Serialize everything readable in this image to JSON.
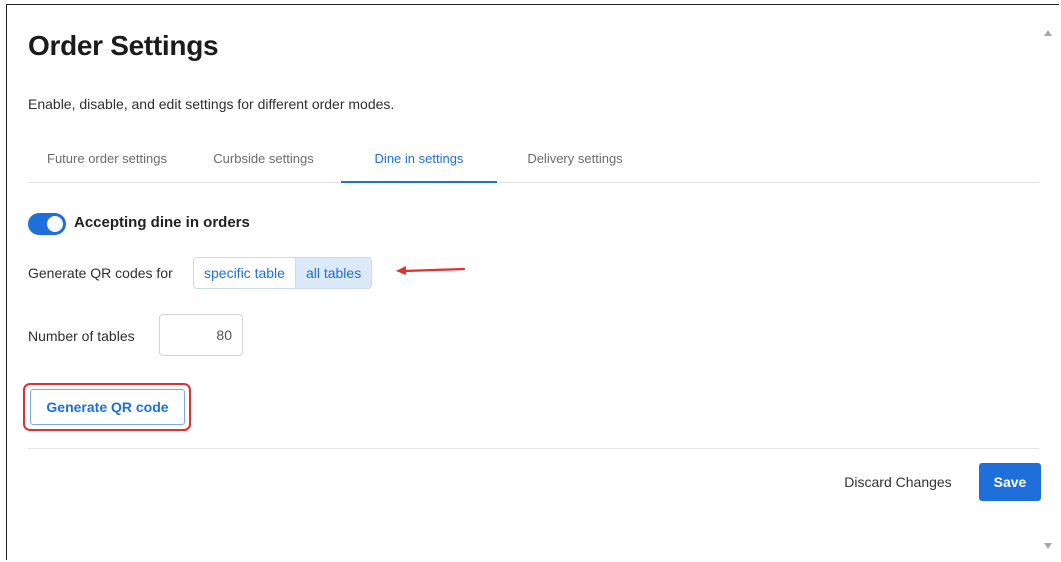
{
  "page": {
    "title": "Order Settings",
    "subtitle": "Enable, disable, and edit settings for different order modes."
  },
  "tabs": [
    {
      "label": "Future order settings",
      "active": false
    },
    {
      "label": "Curbside settings",
      "active": false
    },
    {
      "label": "Dine in settings",
      "active": true
    },
    {
      "label": "Delivery settings",
      "active": false
    }
  ],
  "dine_in": {
    "toggle_on": true,
    "toggle_label": "Accepting dine in orders",
    "qr_label": "Generate QR codes for",
    "qr_options": [
      "specific table",
      "all tables"
    ],
    "qr_selected": "all tables",
    "tables_label": "Number of tables",
    "tables_value": "80",
    "generate_label": "Generate QR code"
  },
  "footer": {
    "discard_label": "Discard Changes",
    "save_label": "Save"
  },
  "icons": {
    "annotation_arrow": "arrow-left-icon",
    "scroll_up": "triangle-up-icon",
    "scroll_down": "triangle-down-icon"
  },
  "colors": {
    "accent": "#1e6fd9",
    "selected_segment": "#dce9f8",
    "annotation": "#e03131"
  }
}
